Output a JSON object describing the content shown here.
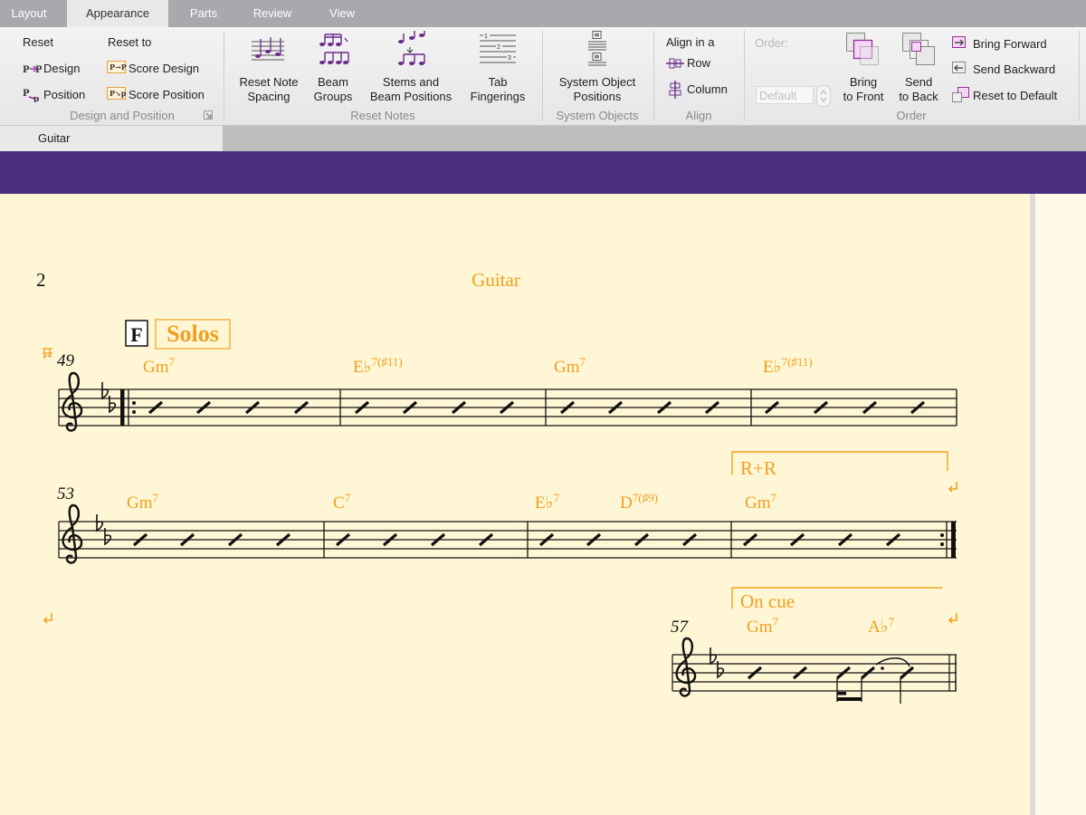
{
  "tabs": [
    "Layout",
    "Appearance",
    "Parts",
    "Review",
    "View"
  ],
  "active_tab": "Appearance",
  "ribbon": {
    "design_position": {
      "reset_label": "Reset",
      "reset_to_label": "Reset to",
      "design_label": "Design",
      "position_label": "Position",
      "score_design_label": "Score Design",
      "score_position_label": "Score Position",
      "group_label": "Design and Position"
    },
    "reset_notes": {
      "note_spacing_label": [
        "Reset Note",
        "Spacing"
      ],
      "beam_groups_label": [
        "Beam",
        "Groups"
      ],
      "stems_label": [
        "Stems and",
        "Beam Positions"
      ],
      "tab_fingerings_label": [
        "Tab",
        "Fingerings"
      ],
      "group_label": "Reset Notes"
    },
    "system_objects": {
      "positions_label": [
        "System Object",
        "Positions"
      ],
      "group_label": "System Objects"
    },
    "align": {
      "align_in_a_label": "Align in a",
      "row_label": "Row",
      "column_label": "Column",
      "group_label": "Align"
    },
    "order": {
      "order_label": "Order:",
      "order_value": "Default",
      "bring_front_label": [
        "Bring",
        "to Front"
      ],
      "send_back_label": [
        "Send",
        "to Back"
      ],
      "bring_forward_label": "Bring Forward",
      "send_backward_label": "Send Backward",
      "reset_default_label": "Reset to Default",
      "group_label": "Order"
    }
  },
  "document_tab": "Guitar",
  "score": {
    "page_number": "2",
    "part_title": "Guitar",
    "rehearsal_mark": "F",
    "section_text": "Solos",
    "bar_numbers": [
      "49",
      "53",
      "57"
    ],
    "system1_chords": [
      {
        "root": "Gm",
        "ext": "7"
      },
      {
        "root": "E♭",
        "ext": "7(♯11)"
      },
      {
        "root": "Gm",
        "ext": "7"
      },
      {
        "root": "E♭",
        "ext": "7(♯11)"
      }
    ],
    "system2_chords": [
      {
        "root": "Gm",
        "ext": "7"
      },
      {
        "root": "C",
        "ext": "7"
      },
      {
        "root": "E♭",
        "ext": "7"
      },
      {
        "root": "D",
        "ext": "7(♯9)"
      },
      {
        "root": "Gm",
        "ext": "7"
      }
    ],
    "system3_chords": [
      {
        "root": "Gm",
        "ext": "7"
      },
      {
        "root": "A♭",
        "ext": "7"
      }
    ],
    "ending_text_1": "R+R",
    "ending_text_2": "On cue",
    "accent_color": "#f0a020",
    "purple_color": "#4b2e7c"
  }
}
